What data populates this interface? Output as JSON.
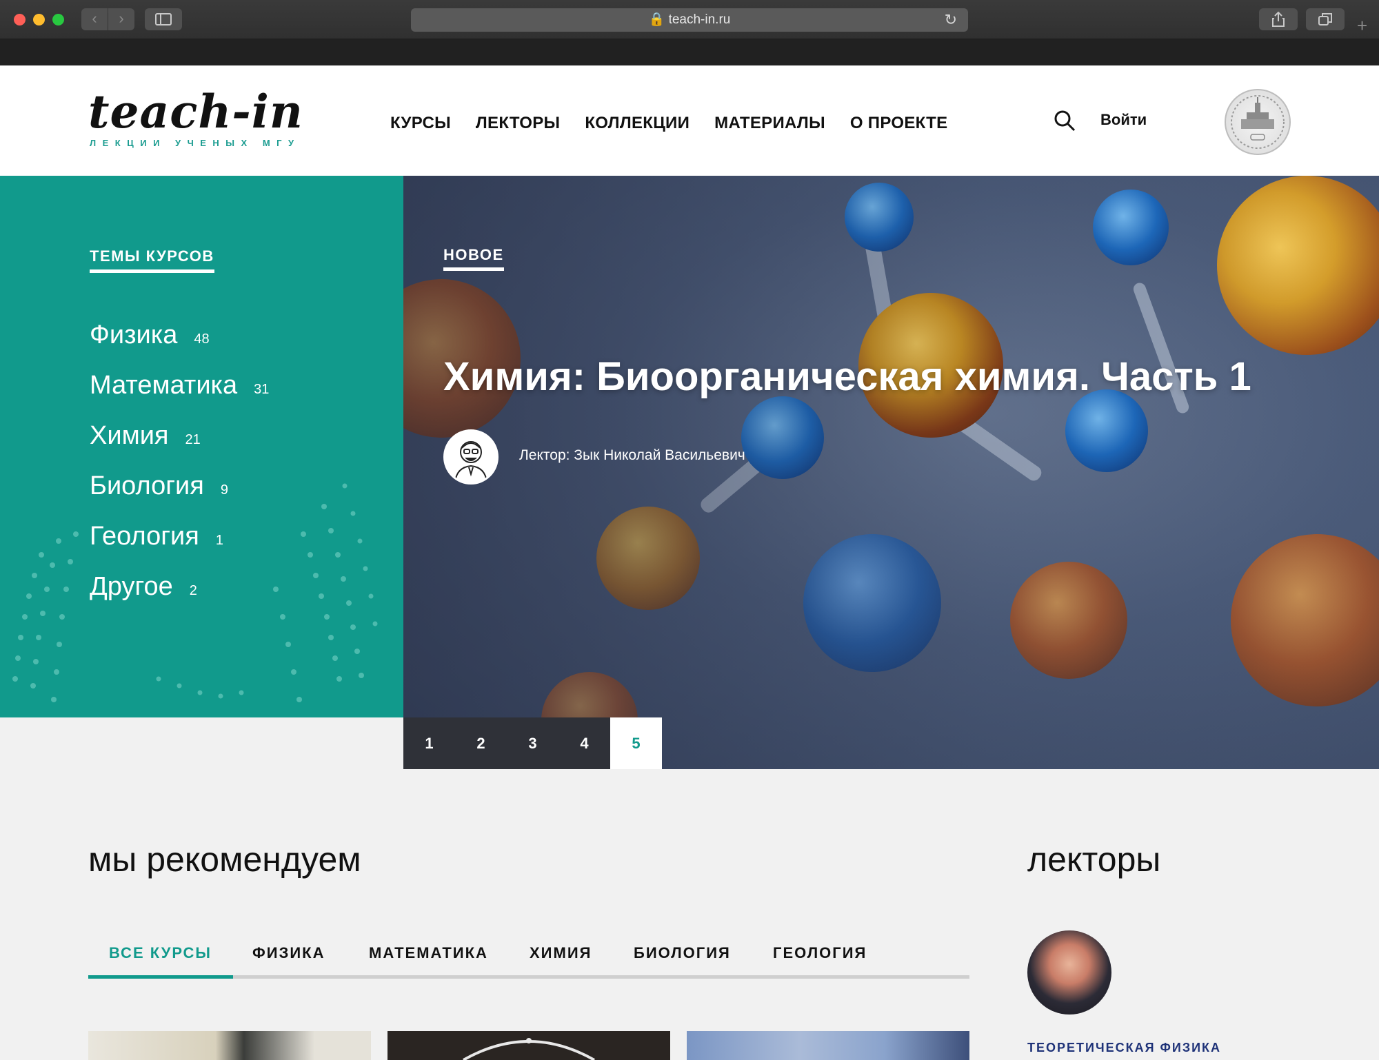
{
  "browser": {
    "url": "teach-in.ru"
  },
  "header": {
    "logo_text": "teach-in",
    "logo_subtitle": "ЛЕКЦИИ УЧЕНЫХ МГУ",
    "nav": [
      "КУРСЫ",
      "ЛЕКТОРЫ",
      "КОЛЛЕКЦИИ",
      "МАТЕРИАЛЫ",
      "О ПРОЕКТЕ"
    ],
    "login": "Войти"
  },
  "themes": {
    "title": "ТЕМЫ КУРСОВ",
    "items": [
      {
        "name": "Физика",
        "count": "48"
      },
      {
        "name": "Математика",
        "count": "31"
      },
      {
        "name": "Химия",
        "count": "21"
      },
      {
        "name": "Биология",
        "count": "9"
      },
      {
        "name": "Геология",
        "count": "1"
      },
      {
        "name": "Другое",
        "count": "2"
      }
    ]
  },
  "hero": {
    "label": "НОВОЕ",
    "title": "Химия: Биоорганическая химия. Часть 1",
    "lecturer": "Лектор: Зык Николай Васильевич",
    "pages": [
      "1",
      "2",
      "3",
      "4",
      "5"
    ],
    "active_page": "5"
  },
  "recommend": {
    "title": "мы рекомендуем",
    "tabs": [
      "ВСЕ КУРСЫ",
      "ФИЗИКА",
      "МАТЕМАТИКА",
      "ХИМИЯ",
      "БИОЛОГИЯ",
      "ГЕОЛОГИЯ"
    ]
  },
  "lecturers": {
    "title": "лекторы",
    "first_category": "ТЕОРЕТИЧЕСКАЯ ФИЗИКА"
  },
  "colors": {
    "accent": "#119a8c",
    "dark_pager": "#2f3138",
    "category_blue": "#1e3278"
  }
}
